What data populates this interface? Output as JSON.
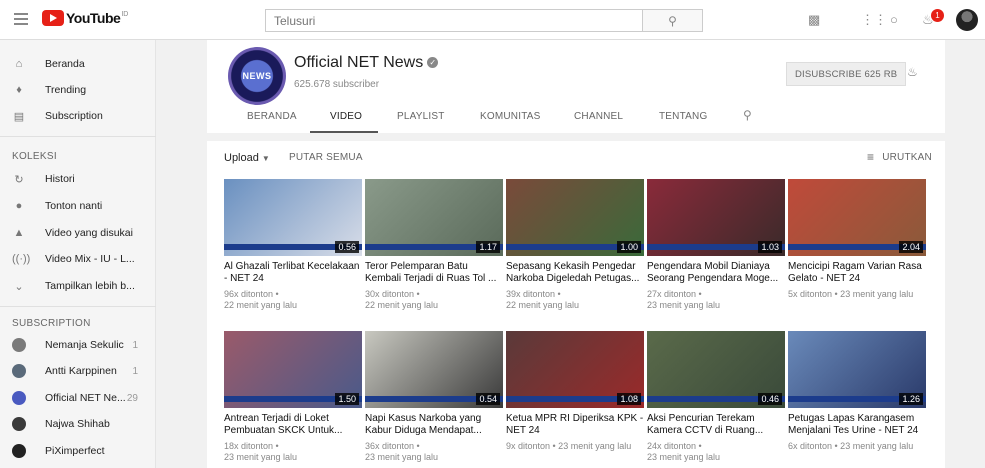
{
  "header": {
    "logo_text": "YouTube",
    "logo_region": "ID",
    "search_placeholder": "Telusuri",
    "notification_count": "1"
  },
  "sidebar": {
    "main_items": [
      {
        "label": "Beranda",
        "icon": "home-icon"
      },
      {
        "label": "Trending",
        "icon": "trending-icon"
      },
      {
        "label": "Subscription",
        "icon": "subscription-icon"
      }
    ],
    "collection_heading": "KOLEKSI",
    "collection_items": [
      {
        "label": "Histori",
        "icon": "history-icon"
      },
      {
        "label": "Tonton nanti",
        "icon": "clock-icon"
      },
      {
        "label": "Video yang disukai",
        "icon": "thumbs-up-icon"
      },
      {
        "label": "Video Mix - IU - L...",
        "icon": "mix-icon"
      },
      {
        "label": "Tampilkan lebih b...",
        "icon": "chevron-down-icon"
      }
    ],
    "subscription_heading": "SUBSCRIPTION",
    "subscriptions": [
      {
        "label": "Nemanja Sekulic",
        "count": "1",
        "color": "#7a7a7a"
      },
      {
        "label": "Antti Karppinen",
        "count": "1",
        "color": "#5a6a7a"
      },
      {
        "label": "Official NET Ne...",
        "count": "29",
        "color": "#4a5ac0"
      },
      {
        "label": "Najwa Shihab",
        "count": "",
        "color": "#3a3a3a"
      },
      {
        "label": "PiXimperfect",
        "count": "",
        "color": "#222222"
      }
    ]
  },
  "channel": {
    "avatar_text": "NEWS",
    "name": "Official NET News",
    "subscribers": "625.678 subscriber",
    "subscribe_button": "DISUBSCRIBE  625 RB"
  },
  "tabs": [
    "BERANDA",
    "VIDEO",
    "PLAYLIST",
    "KOMUNITAS",
    "CHANNEL",
    "TENTANG"
  ],
  "active_tab": "VIDEO",
  "toolbar": {
    "upload_label": "Upload",
    "play_all_label": "PUTAR SEMUA",
    "sort_label": "URUTKAN"
  },
  "videos": [
    {
      "title": "Al Ghazali Terlibat Kecelakaan - NET 24",
      "views": "96x ditonton •",
      "time": "22 menit yang lalu",
      "duration": "0.56",
      "colors": [
        "#6a90c0",
        "#d8dde8"
      ]
    },
    {
      "title": "Teror Pelemparan Batu Kembali Terjadi di Ruas Tol ...",
      "views": "30x ditonton •",
      "time": "22 menit yang lalu",
      "duration": "1.17",
      "colors": [
        "#8a9a8a",
        "#5a6a5a"
      ]
    },
    {
      "title": "Sepasang Kekasih Pengedar Narkoba Digeledah Petugas...",
      "views": "39x ditonton •",
      "time": "22 menit yang lalu",
      "duration": "1.00",
      "colors": [
        "#7a4a3a",
        "#3a6a3a"
      ]
    },
    {
      "title": "Pengendara Mobil Dianiaya Seorang Pengendara Moge...",
      "views": "27x ditonton •",
      "time": "23 menit yang lalu",
      "duration": "1.03",
      "colors": [
        "#8a2a3a",
        "#3a2a2a"
      ]
    },
    {
      "title": "Mencicipi Ragam Varian Rasa Gelato - NET 24",
      "views": "5x ditonton • 23 menit yang lalu",
      "time": "",
      "duration": "2.04",
      "colors": [
        "#c04a3a",
        "#8a5a3a"
      ]
    },
    {
      "title": "Antrean Terjadi di Loket Pembuatan SKCK Untuk...",
      "views": "18x ditonton •",
      "time": "23 menit yang lalu",
      "duration": "1.50",
      "colors": [
        "#9a5a6a",
        "#4a5a8a"
      ]
    },
    {
      "title": "Napi Kasus Narkoba yang Kabur Diduga Mendapat...",
      "views": "36x ditonton •",
      "time": "23 menit yang lalu",
      "duration": "0.54",
      "colors": [
        "#c8c8c0",
        "#3a3a3a"
      ]
    },
    {
      "title": "Ketua MPR RI Diperiksa KPK - NET 24",
      "views": "9x ditonton • 23 menit yang lalu",
      "time": "",
      "duration": "1.08",
      "colors": [
        "#5a3a3a",
        "#9a2a2a"
      ]
    },
    {
      "title": "Aksi Pencurian Terekam Kamera CCTV di Ruang...",
      "views": "24x ditonton •",
      "time": "23 menit yang lalu",
      "duration": "0.46",
      "colors": [
        "#5a6a4a",
        "#3a4a3a"
      ]
    },
    {
      "title": "Petugas Lapas Karangasem Menjalani Tes Urine - NET 24",
      "views": "6x ditonton • 23 menit yang lalu",
      "time": "",
      "duration": "1.26",
      "colors": [
        "#6a8aba",
        "#2a3a6a"
      ]
    }
  ]
}
